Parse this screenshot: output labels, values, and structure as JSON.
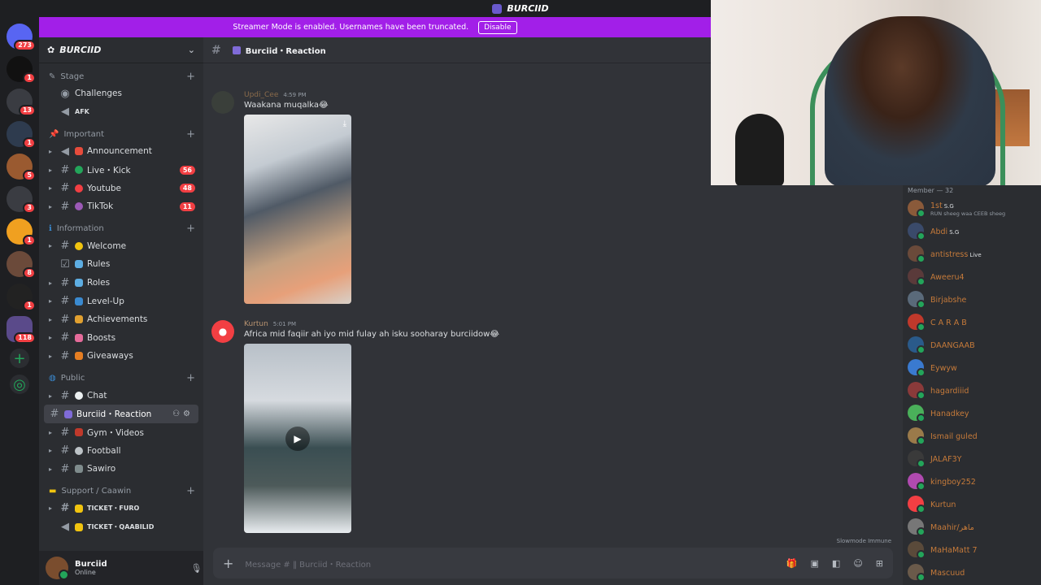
{
  "window": {
    "title": "BURCIID"
  },
  "banner": {
    "text": "Streamer Mode is enabled. Usernames have been truncated.",
    "button": "Disable",
    "color": "#a21fe8"
  },
  "rail": {
    "servers": [
      {
        "badge": "273",
        "color": "#5865f2"
      },
      {
        "badge": "1",
        "color": "#1e1e1e"
      },
      {
        "badge": "13",
        "color": "#3a3c42"
      },
      {
        "badge": "1",
        "color": "#2e3b4e"
      },
      {
        "badge": "5",
        "color": "#9a5a30"
      },
      {
        "badge": "3",
        "color": "#3a3c42"
      },
      {
        "badge": "1",
        "color": "#f0a020"
      },
      {
        "badge": "8",
        "color": "#6b4a3a"
      },
      {
        "badge": "1",
        "color": "#222"
      },
      {
        "badge": "118",
        "color": "#5a4a8a"
      }
    ]
  },
  "sidebar": {
    "guild_name": "BURCIID",
    "categories": {
      "stage": "Stage",
      "important": "Important",
      "information": "Information",
      "public": "Public",
      "support": "Support / Caawin"
    },
    "channels": {
      "challenges": "Challenges",
      "afk": "AFK",
      "announcement": "Announcement",
      "live_kick": "Live・Kick",
      "youtube": "Youtube",
      "tiktok": "TikTok",
      "welcome": "Welcome",
      "rules": "Rules",
      "roles": "Roles",
      "levelup": "Level-Up",
      "achievements": "Achievements",
      "boosts": "Boosts",
      "giveaways": "Giveaways",
      "chat": "Chat",
      "reaction": "Burciid・Reaction",
      "gym": "Gym・Videos",
      "football": "Football",
      "sawiro": "Sawiro",
      "ticket_furo": "TICKET・FURO",
      "ticket_qaabilid": "TICKET・QAABILID"
    },
    "counts": {
      "live_kick": "56",
      "youtube": "48",
      "tiktok": "11"
    }
  },
  "user": {
    "name": "Burciid",
    "status": "Online"
  },
  "chat": {
    "channel_title": "Burciid・Reaction",
    "messages": [
      {
        "author": "Updi_Cee",
        "time": "4:59 PM",
        "text": "Waakana muqalka😂"
      },
      {
        "author": "Kurtun",
        "time": "5:01 PM",
        "text": "Africa mid faqiir ah iyo mid fulay ah isku sooharay burciidow😂"
      }
    ],
    "composer_placeholder": "Message #  ‖ Burciid・Reaction",
    "slowmode": "Slowmode Immune"
  },
  "members": {
    "header": "Member — 32",
    "list": [
      {
        "name": "1st",
        "tag": "S.G",
        "sub": "RUN sheeg waa CEEB sheeg",
        "color": "#8a5a3a"
      },
      {
        "name": "Abdi",
        "tag": "S.G",
        "sub": "",
        "color": "#3a4a6a"
      },
      {
        "name": "antistress",
        "tag": "Live",
        "sub": "",
        "color": "#6a4a3a"
      },
      {
        "name": "Aweeru4",
        "tag": "",
        "sub": "",
        "color": "#5a3a3a"
      },
      {
        "name": "Birjabshe",
        "tag": "",
        "sub": "",
        "color": "#5a6a7a"
      },
      {
        "name": "C A R A B",
        "tag": "",
        "sub": "",
        "color": "#c0392b"
      },
      {
        "name": "DAANGAAB",
        "tag": "",
        "sub": "",
        "color": "#2a5a8a"
      },
      {
        "name": "Eywyw",
        "tag": "",
        "sub": "",
        "color": "#3a7ad0"
      },
      {
        "name": "hagardiiid",
        "tag": "",
        "sub": "",
        "color": "#8a3a3a"
      },
      {
        "name": "Hanadkey",
        "tag": "",
        "sub": "",
        "color": "#4ab05a"
      },
      {
        "name": "Ismail guled",
        "tag": "",
        "sub": "",
        "color": "#9a7a4a"
      },
      {
        "name": "JALAF3Y",
        "tag": "",
        "sub": "",
        "color": "#3a3a3a"
      },
      {
        "name": "kingboy252",
        "tag": "",
        "sub": "",
        "color": "#b04ab0"
      },
      {
        "name": "Kurtun",
        "tag": "",
        "sub": "",
        "color": "#f23f43"
      },
      {
        "name": "Maahir/ماهر",
        "tag": "",
        "sub": "",
        "color": "#777"
      },
      {
        "name": "MaHaMatt 7",
        "tag": "",
        "sub": "",
        "color": "#5a4a3a"
      },
      {
        "name": "Mascuud",
        "tag": "",
        "sub": "",
        "color": "#6a5a4a"
      }
    ]
  }
}
